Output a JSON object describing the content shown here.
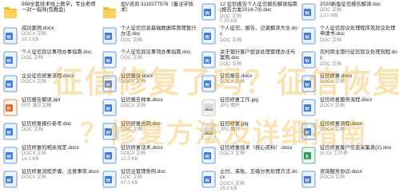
{
  "files": [
    {
      "name": "998全套技术线上教学，专业老师一对一指导(包教会)",
      "type": "",
      "size": "",
      "icon": "folder"
    },
    {
      "name": "加V咨询 3110277576（备注学技术）",
      "type": "",
      "size": "",
      "icon": "folder"
    },
    {
      "name": "12 征信报告个人征信报告解读指南(报告力发2014-73).doc",
      "type": "DOC 文档",
      "size": "7.25 KB",
      "icon": "word"
    },
    {
      "name": "2020新版征信报告解读.doc",
      "type": "DOC 文档",
      "size": "2.01 MB",
      "icon": "word"
    },
    {
      "name": "成功案例.docx",
      "type": "DOCX 文档",
      "size": "19.3 KB",
      "icon": "word"
    },
    {
      "name": "个人征信信息基础数据库管理暂行办法.doc",
      "type": "DOC 文档",
      "size": "",
      "icon": "word"
    },
    {
      "name": "个人征信、报告、记录解读大全.doc",
      "type": "DOC 文档",
      "size": "",
      "icon": "word"
    },
    {
      "name": "个人征信异议处理程序及异议处理申请书.doc",
      "type": "DOC 文档",
      "size": "",
      "icon": "word"
    },
    {
      "name": "个人征信异议事项办事指南.doc",
      "type": "DOC 文档",
      "size": "",
      "icon": "word"
    },
    {
      "name": "个人征信异议事项办事指南.doc",
      "type": "DOC 文档",
      "size": "",
      "icon": "word"
    },
    {
      "name": "关于银行客户投诉处理管理办法与案例.doc",
      "type": "DOC 文档",
      "size": "",
      "icon": "word"
    },
    {
      "name": "农村商业银行征信异议处理规程.doc",
      "type": "DOC 文档",
      "size": "",
      "icon": "word"
    },
    {
      "name": "企业征信修复流程.docx",
      "type": "DOCX 文档",
      "size": "",
      "icon": "word"
    },
    {
      "name": "征信报告.docx",
      "type": "DOCX 文档",
      "size": "",
      "icon": "word"
    },
    {
      "name": "征信报告.docx",
      "type": "DOCX 文档",
      "size": "",
      "icon": "word"
    },
    {
      "name": "征信修复.docx",
      "type": "DOCX 文档",
      "size": "",
      "icon": "word"
    },
    {
      "name": "征信报告解读.ppt",
      "type": "PPT 演示文稿",
      "size": "",
      "icon": "ppt"
    },
    {
      "name": "征信报告样本.docx",
      "type": "DOCX 文档",
      "size": "",
      "icon": "word"
    },
    {
      "name": "征信修复工作.jpg",
      "type": "JPG 图片",
      "size": "",
      "icon": "image"
    },
    {
      "name": "征信修复服务流程.docx",
      "type": "DOCX 文档",
      "size": "",
      "icon": "word"
    },
    {
      "name": "征信修复报价参考.doc",
      "type": "DOC 文档",
      "size": "",
      "icon": "word"
    },
    {
      "name": "征信修复合同.doc",
      "type": "DOC 文档",
      "size": "",
      "icon": "word"
    },
    {
      "name": "征信修复.jpg",
      "type": "JPG 图片",
      "size": "",
      "icon": "image"
    },
    {
      "name": "征信修复流程.docx",
      "type": "DOCX 文档",
      "size": "",
      "icon": "word"
    },
    {
      "name": "征信修复的相关规定.docx",
      "type": "DOCX 文档",
      "size": "14.1 KB",
      "icon": "word"
    },
    {
      "name": "征信修复话术.docx",
      "type": "DOCX 文档",
      "size": "12.2 KB",
      "icon": "word"
    },
    {
      "name": "征信修复技术（核心资料）.docx",
      "type": "DOCX 文档",
      "size": "",
      "icon": "word"
    },
    {
      "name": "征信修复客户信息采集表(2).xlsx",
      "type": "XLSX 工作表",
      "size": "",
      "icon": "excel"
    },
    {
      "name": "征信修复流程步骤、注意事项.docx",
      "type": "DOCX 文档",
      "size": "",
      "icon": "word"
    },
    {
      "name": "征信业管理条例.doc",
      "type": "DOC 文档",
      "size": "47.0 KB",
      "icon": "word"
    },
    {
      "name": "止付、呆账、五级分类处理方法.docx",
      "type": "DOCX 文档",
      "size": "15.0 KB",
      "icon": "word"
    },
    {
      "name": "咨询服务协议.docx",
      "type": "DOCX 文档",
      "size": "",
      "icon": "word"
    }
  ],
  "watermark": {
    "line1": "征信修复了吗？征信恢复",
    "line2": "？修复方法及详细指南"
  },
  "icons": {
    "folder": "folder-icon",
    "word": "word-doc-icon",
    "ppt": "ppt-icon",
    "image": "image-file-icon",
    "excel": "excel-icon"
  },
  "colors": {
    "folder": "#f5b81c",
    "word": "#3b7ae3",
    "ppt": "#e8632d",
    "image": "#eeeeee",
    "excel": "#2a9b55",
    "watermark": "#ecaa14"
  }
}
